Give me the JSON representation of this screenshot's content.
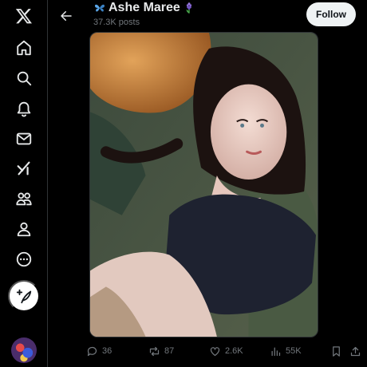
{
  "header": {
    "back_icon": "arrow-left-icon",
    "title": "Ashe Maree",
    "title_prefix_emoji": "butterfly",
    "title_suffix_emoji": "hyacinth",
    "post_count": "37.3K posts",
    "follow_label": "Follow"
  },
  "sidebar": {
    "items": [
      {
        "name": "x-logo",
        "icon": "x-logo-icon"
      },
      {
        "name": "home",
        "icon": "home-icon"
      },
      {
        "name": "explore",
        "icon": "search-icon"
      },
      {
        "name": "notifications",
        "icon": "bell-icon"
      },
      {
        "name": "messages",
        "icon": "envelope-icon"
      },
      {
        "name": "grok",
        "icon": "grok-icon"
      },
      {
        "name": "communities",
        "icon": "people-icon"
      },
      {
        "name": "profile",
        "icon": "person-icon"
      },
      {
        "name": "more",
        "icon": "more-circle-icon"
      }
    ],
    "compose_icon": "feather-plus-icon"
  },
  "media": {
    "type": "photo",
    "subject": "selfie of a woman lying on a green sofa with an orange cat"
  },
  "actions": {
    "reply_count": "36",
    "repost_count": "87",
    "like_count": "2.6K",
    "views_count": "55K"
  },
  "colors": {
    "background": "#000000",
    "text": "#e7e9ea",
    "muted": "#71767b",
    "follow_bg": "#eff3f4",
    "border": "#2f3336"
  }
}
